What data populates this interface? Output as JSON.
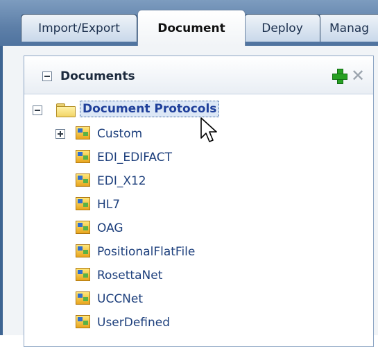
{
  "tabs": [
    {
      "label": "Import/Export",
      "active": false
    },
    {
      "label": "Document",
      "active": true
    },
    {
      "label": "Deploy",
      "active": false
    },
    {
      "label": "Manag",
      "active": false
    }
  ],
  "panel": {
    "title": "Documents"
  },
  "tree": {
    "root": {
      "label": "Document Protocols",
      "expanded": true,
      "selected": true
    },
    "children": [
      {
        "label": "Custom",
        "expandable": true
      },
      {
        "label": "EDI_EDIFACT"
      },
      {
        "label": "EDI_X12"
      },
      {
        "label": "HL7"
      },
      {
        "label": "OAG"
      },
      {
        "label": "PositionalFlatFile"
      },
      {
        "label": "RosettaNet"
      },
      {
        "label": "UCCNet"
      },
      {
        "label": "UserDefined"
      }
    ]
  },
  "icons": {
    "add": "add-icon",
    "delete": "delete-icon",
    "folder": "folder-icon",
    "protocol": "protocol-icon"
  },
  "colors": {
    "tab_bar": "#5d7fa8",
    "link_text": "#1d3f7c",
    "selection_bg": "#dce7f6",
    "add_green": "#27a023"
  }
}
